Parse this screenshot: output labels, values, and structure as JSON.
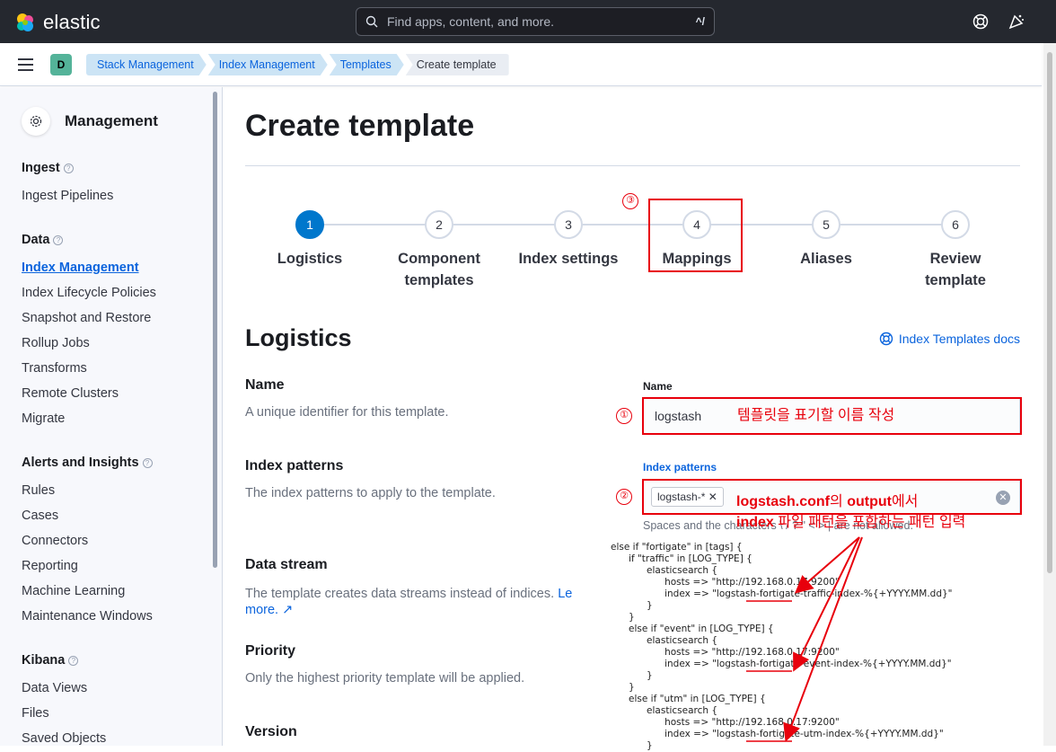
{
  "topbar": {
    "logo_text": "elastic",
    "search_placeholder": "Find apps, content, and more.",
    "search_shortcut": "^/"
  },
  "subbar": {
    "space_initial": "D",
    "breadcrumbs": [
      "Stack Management",
      "Index Management",
      "Templates",
      "Create template"
    ]
  },
  "sidebar": {
    "title": "Management",
    "sections": [
      {
        "title": "Ingest",
        "items": [
          "Ingest Pipelines"
        ]
      },
      {
        "title": "Data",
        "items": [
          "Index Management",
          "Index Lifecycle Policies",
          "Snapshot and Restore",
          "Rollup Jobs",
          "Transforms",
          "Remote Clusters",
          "Migrate"
        ]
      },
      {
        "title": "Alerts and Insights",
        "items": [
          "Rules",
          "Cases",
          "Connectors",
          "Reporting",
          "Machine Learning",
          "Maintenance Windows"
        ]
      },
      {
        "title": "Kibana",
        "items": [
          "Data Views",
          "Files",
          "Saved Objects"
        ]
      }
    ],
    "active_item": "Index Management"
  },
  "main": {
    "title": "Create template",
    "steps": [
      {
        "number": "1",
        "label": "Logistics",
        "active": true
      },
      {
        "number": "2",
        "label": "Component templates",
        "active": false
      },
      {
        "number": "3",
        "label": "Index settings",
        "active": false
      },
      {
        "number": "4",
        "label": "Mappings",
        "active": false
      },
      {
        "number": "5",
        "label": "Aliases",
        "active": false
      },
      {
        "number": "6",
        "label": "Review template",
        "active": false
      }
    ],
    "section_title": "Logistics",
    "docs_link": "Index Templates docs",
    "fields": {
      "name": {
        "title": "Name",
        "desc": "A unique identifier for this template.",
        "label": "Name",
        "value": "logstash"
      },
      "index_patterns": {
        "title": "Index patterns",
        "desc": "The index patterns to apply to the template.",
        "label": "Index patterns",
        "chip": "logstash-*",
        "help": "Spaces and the characters \\ / ? \" < > | are not allowed."
      },
      "data_stream": {
        "title": "Data stream",
        "desc": "The template creates data streams instead of indices.",
        "link1": "Le",
        "link2": "more."
      },
      "priority": {
        "title": "Priority",
        "desc": "Only the highest priority template will be applied."
      },
      "version": {
        "title": "Version"
      }
    }
  },
  "annotations": {
    "marker_1": "①",
    "marker_2": "②",
    "marker_3": "③",
    "name_note": "템플릿을 표기할 이름 작성",
    "pattern_note_part1": "logstash.conf",
    "pattern_note_part2": "의 ",
    "pattern_note_part3": "output",
    "pattern_note_part4": "에서",
    "pattern_note_part5": "index",
    "pattern_note_part6": " 파일 패턴을 포함하는 패턴 입력",
    "color": "#e8000c"
  },
  "code_snippet": [
    "else if \"fortigate\" in [tags] {",
    "      if \"traffic\" in [LOG_TYPE] {",
    "            elasticsearch {",
    "                  hosts => \"http://192.168.0.17:9200\"",
    "                  index => \"logstash-fortigate-traffic-index-%{+YYYY.MM.dd}\"",
    "            }",
    "      }",
    "      else if \"event\" in [LOG_TYPE] {",
    "            elasticsearch {",
    "                  hosts => \"http://192.168.0.17:9200\"",
    "                  index => \"logstash-fortigate-event-index-%{+YYYY.MM.dd}\"",
    "            }",
    "      }",
    "      else if \"utm\" in [LOG_TYPE] {",
    "            elasticsearch {",
    "                  hosts => \"http://192.168.0.17:9200\"",
    "                  index => \"logstash-fortigate-utm-index-%{+YYYY.MM.dd}\"",
    "            }"
  ]
}
